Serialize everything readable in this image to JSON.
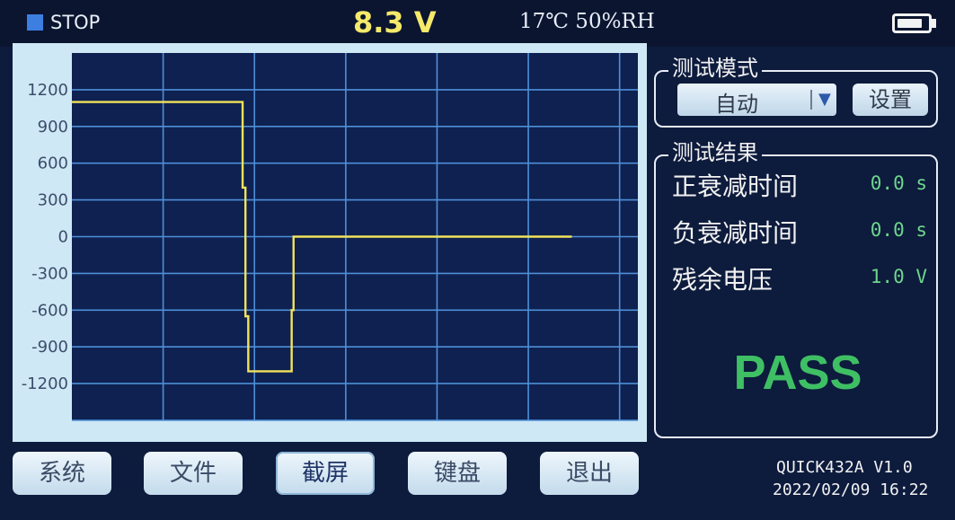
{
  "status": {
    "run_state": "STOP",
    "voltage": "8.3 V",
    "environment": "17℃ 50%RH",
    "battery_level": 0.85
  },
  "chart_data": {
    "type": "line",
    "y_ticks": [
      "1200",
      "900",
      "600",
      "300",
      "0",
      "-300",
      "-600",
      "-900",
      "-1200"
    ],
    "ylim": [
      -1500,
      1500
    ],
    "grid": true,
    "line_color": "#f2e35a",
    "series": [
      {
        "points": [
          [
            0,
            1100
          ],
          [
            181,
            1100
          ],
          [
            181,
            400
          ],
          [
            184,
            400
          ],
          [
            184,
            -650
          ],
          [
            187,
            -650
          ],
          [
            187,
            -1100
          ],
          [
            233,
            -1100
          ],
          [
            233,
            -600
          ],
          [
            235,
            -600
          ],
          [
            235,
            0
          ],
          [
            530,
            0
          ]
        ]
      }
    ],
    "x_extent": [
      0,
      600
    ]
  },
  "test_mode": {
    "title": "测试模式",
    "selected": "自动",
    "settings_label": "设置"
  },
  "test_result": {
    "title": "测试结果",
    "rows": [
      {
        "label": "正衰减时间",
        "value": "0.0 s"
      },
      {
        "label": "负衰减时间",
        "value": "0.0 s"
      },
      {
        "label": "残余电压",
        "value": "1.0 V"
      }
    ],
    "verdict": "PASS"
  },
  "buttons": {
    "system": "系统",
    "file": "文件",
    "screenshot": "截屏",
    "keyboard": "键盘",
    "exit": "退出"
  },
  "footer": {
    "model": "QUICK432A V1.0",
    "datetime": "2022/02/09 16:22"
  }
}
